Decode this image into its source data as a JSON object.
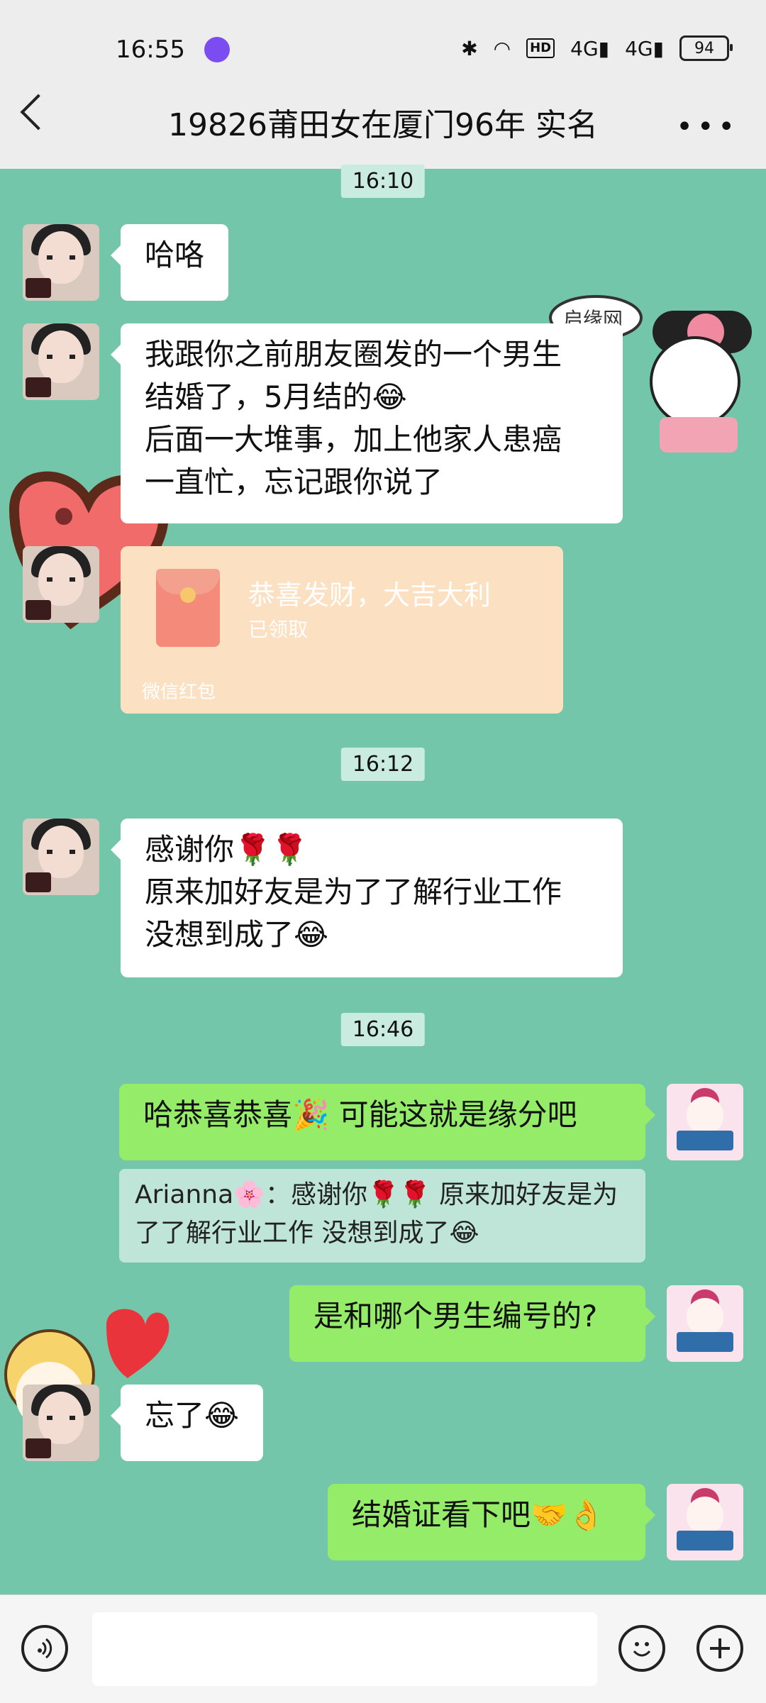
{
  "status_bar": {
    "time": "16:55",
    "battery": "94",
    "hd_label": "HD",
    "signal_1": "4G",
    "signal_2": "4G"
  },
  "header": {
    "title": "19826莆田女在厦门96年  实名",
    "more": "•••"
  },
  "chat": {
    "timestamps": {
      "t1": "16:10",
      "t2": "16:12",
      "t3": "16:46"
    },
    "messages": {
      "m1": "哈咯",
      "m2_l1": "我跟你之前朋友圈发的一个男生",
      "m2_l2": "结婚了，5月结的😂",
      "m2_l3": "后面一大堆事，加上他家人患癌",
      "m2_l4": "一直忙，忘记跟你说了",
      "m4_l1": "感谢你🌹🌹",
      "m4_l2": "原来加好友是为了了解行业工作",
      "m4_l3": "没想到成了😂",
      "m5": "哈恭喜恭喜🎉  可能这就是缘分吧",
      "quote_l1": "Arianna🌸：感谢你🌹🌹 原来加好友是为",
      "quote_l2": "了了解行业工作 没想到成了😂",
      "m6": "是和哪个男生编号的?",
      "m7": "忘了😂",
      "m8": "结婚证看下吧🤝👌"
    },
    "red_packet": {
      "title": "恭喜发财，大吉大利",
      "status": "已领取",
      "label": "微信红包"
    }
  },
  "stickers": {
    "sticker_1_text": "启缘网"
  },
  "input_bar": {
    "voice_icon": "voice-icon",
    "emoji_icon": "emoji-icon",
    "add_icon": "add-icon"
  },
  "colors": {
    "chat_bg": "#74c6aa",
    "incoming": "#ffffff",
    "outgoing": "#95ec69",
    "red_packet": "#fbe0c2"
  }
}
